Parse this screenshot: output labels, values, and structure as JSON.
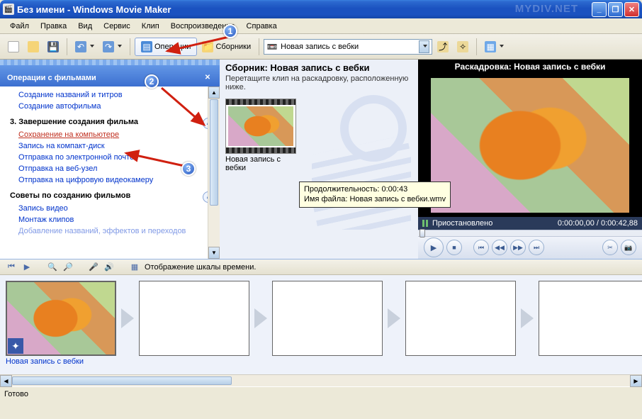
{
  "window": {
    "title": "Без имени - Windows Movie Maker",
    "watermark": "MYDIV.NET"
  },
  "menu": {
    "file": "Файл",
    "edit": "Правка",
    "view": "Вид",
    "service": "Сервис",
    "clip": "Клип",
    "playback": "Воспроизведение",
    "help": "Справка"
  },
  "toolbar": {
    "ops": "Операции",
    "coll": "Сборники",
    "combo_value": "Новая запись с вебки"
  },
  "tasks": {
    "header": "Операции с фильмами",
    "link_titles": "Создание названий и титров",
    "link_automovie": "Создание автофильма",
    "section3": "3. Завершение создания фильма",
    "link_save_pc": "Сохранение на компьютере",
    "link_cd": "Запись на компакт-диск",
    "link_email": "Отправка по электронной почте",
    "link_web": "Отправка на веб-узел",
    "link_dv": "Отправка на цифровую видеокамеру",
    "section_tips": "Советы по созданию фильмов",
    "link_rec": "Запись видео",
    "link_edit": "Монтаж клипов",
    "link_addfx": "Добавление названий, эффектов и переходов"
  },
  "collection": {
    "title": "Сборник: Новая запись с вебки",
    "sub": "Перетащите клип на раскадровку, расположенную ниже.",
    "clip_label": "Новая запись с вебки",
    "tooltip_dur": "Продолжительность:  0:00:43",
    "tooltip_file": "Имя файла: Новая запись с вебки.wmv"
  },
  "preview": {
    "title": "Раскадровка: Новая запись с вебки",
    "status": "Приостановлено",
    "time": "0:00:00,00 / 0:00:42,88"
  },
  "storyboard": {
    "toggle": "Отображение шкалы времени.",
    "clip_label": "Новая запись с вебки"
  },
  "status": "Готово",
  "anno": {
    "b1": "1",
    "b2": "2",
    "b3": "3"
  }
}
